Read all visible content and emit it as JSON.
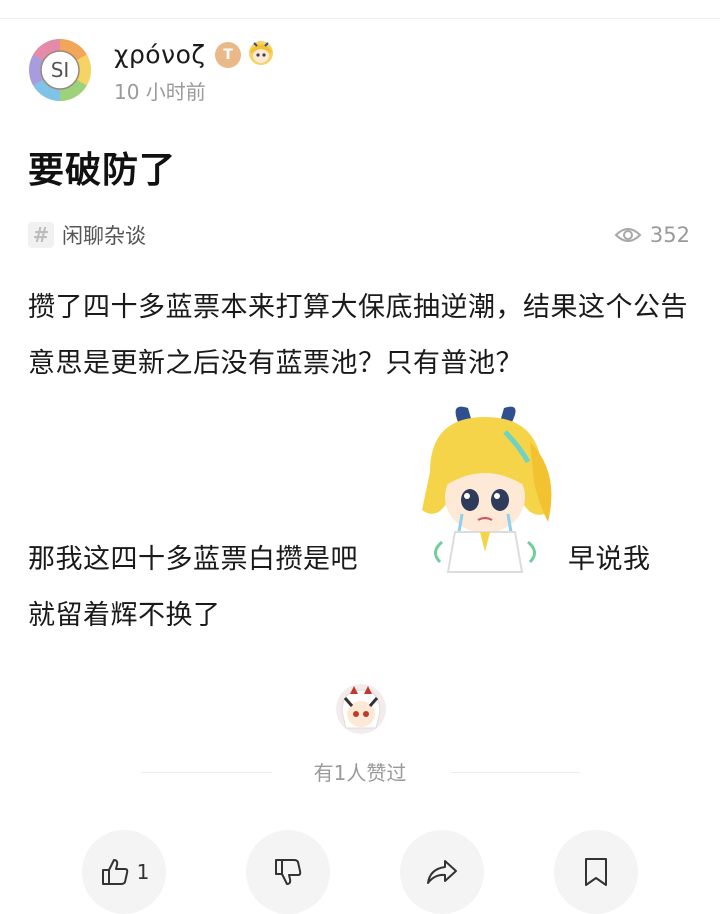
{
  "author": {
    "avatar_text": "SI",
    "name": "χρόνοζ",
    "badge_letter": "T",
    "time_ago": "10 小时前"
  },
  "post": {
    "title": "要破防了",
    "tag": "闲聊杂谈",
    "views": "352",
    "paragraph_1": "攒了四十多蓝票本来打算大保底抽逆潮，结果这个公告意思是更新之后没有蓝票池？只有普池？",
    "paragraph_2_left": "那我这四十多蓝票白攒是吧",
    "paragraph_2_right": "早说我",
    "paragraph_3": "就留着辉不换了"
  },
  "likes": {
    "summary": "有1人赞过"
  },
  "actions": {
    "like_count": "1"
  },
  "icons": [
    "hash-icon",
    "eye-icon",
    "thumbs-up-icon",
    "thumbs-down-icon",
    "share-icon",
    "bookmark-icon"
  ],
  "colors": {
    "muted_text": "#9a9a9a",
    "action_bg": "#f4f4f4",
    "badge_bg": "#e9b98a"
  }
}
